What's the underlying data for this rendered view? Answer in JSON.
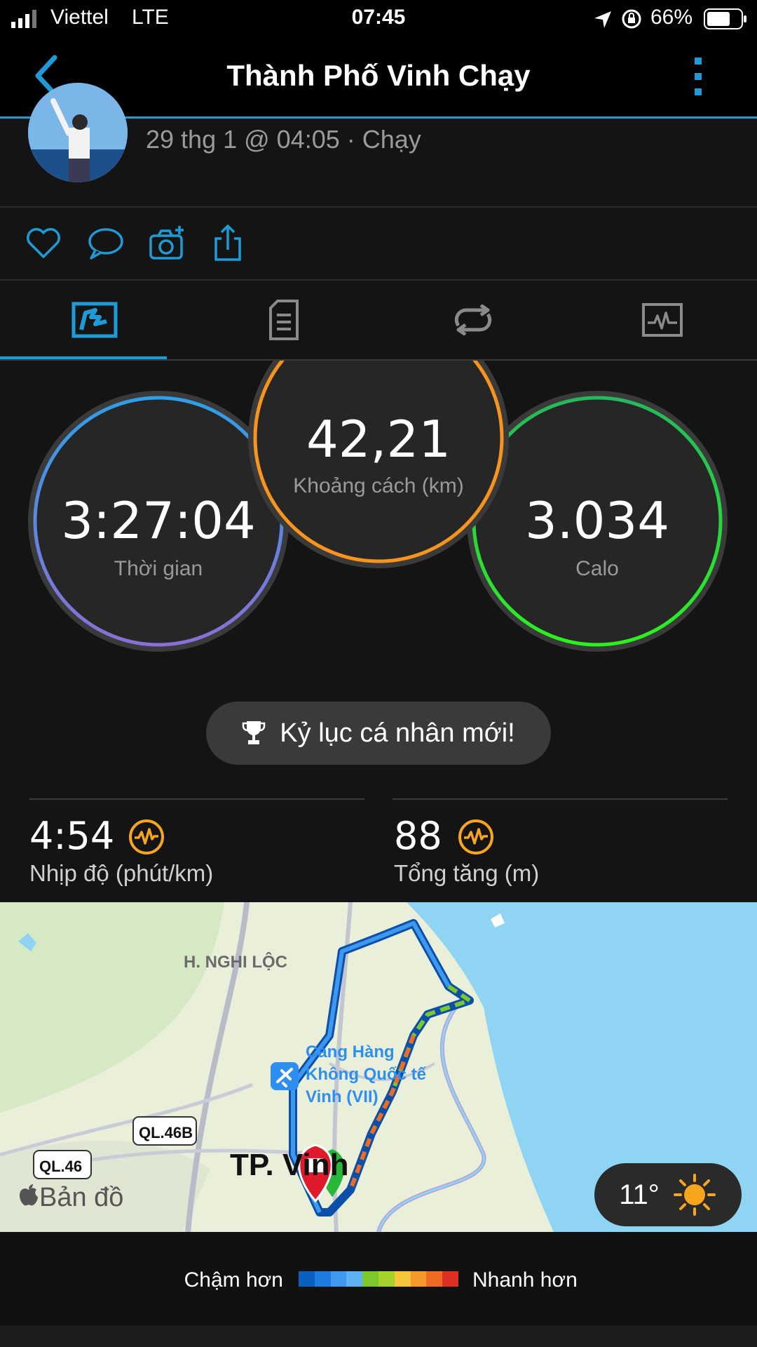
{
  "status_bar": {
    "carrier": "Viettel",
    "network": "LTE",
    "time": "07:45",
    "battery": "66%"
  },
  "nav": {
    "title": "Thành Phố Vinh Chạy"
  },
  "activity": {
    "meta": "29 thg 1 @ 04:05 · Chạy"
  },
  "stats": {
    "time": {
      "value": "3:27:04",
      "label": "Thời gian"
    },
    "distance": {
      "value": "42,21",
      "label": "Khoảng cách (km)"
    },
    "calories": {
      "value": "3.034",
      "label": "Calo"
    }
  },
  "personal_record": {
    "label": "Kỷ lục cá nhân mới!"
  },
  "pace": {
    "value": "4:54",
    "label": "Nhịp độ (phút/km)"
  },
  "elevation": {
    "value": "88",
    "label": "Tổng tăng (m)"
  },
  "map": {
    "place_label": "H. NGHI LỘC",
    "airport_label_1": "Cảng Hàng",
    "airport_label_2": "Không Quốc tế",
    "airport_label_3": "Vinh (VII)",
    "road_1": "QL.46B",
    "road_2": "QL.46",
    "city_label": "TP. Vinh",
    "attribution": "Bản đồ",
    "weather_temp": "11°"
  },
  "legend": {
    "slower": "Chậm hơn",
    "faster": "Nhanh hơn",
    "colors": [
      "#0a5fbf",
      "#1e7be0",
      "#3d98ee",
      "#5fb2f2",
      "#7cc82a",
      "#a6d22c",
      "#f5c63a",
      "#f59a2a",
      "#ef6a22",
      "#dd2f22"
    ]
  },
  "colors": {
    "accent": "#1e9bd7",
    "distance_ring": "#f7941d",
    "calories_ring": "#22d132",
    "time_ring": "#3a8fe0"
  }
}
